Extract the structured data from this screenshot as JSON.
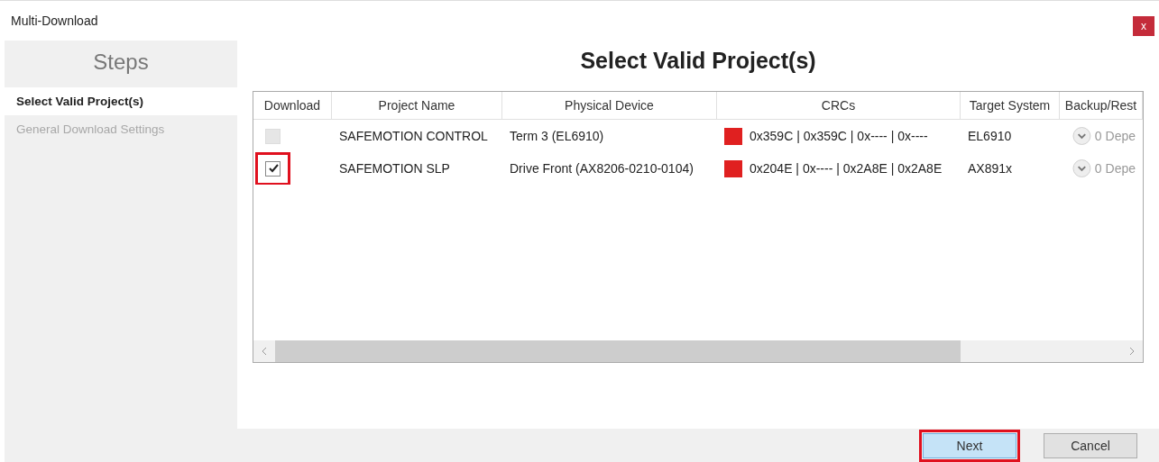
{
  "window": {
    "title": "Multi-Download",
    "close_label": "x"
  },
  "sidebar": {
    "title": "Steps",
    "items": [
      {
        "label": "Select Valid Project(s)",
        "selected": true,
        "disabled": false
      },
      {
        "label": "General Download Settings",
        "selected": false,
        "disabled": true
      }
    ]
  },
  "page_title": "Select Valid Project(s)",
  "table": {
    "columns": [
      "Download",
      "Project Name",
      "Physical Device",
      "CRCs",
      "Target System",
      "Backup/Rest"
    ],
    "rows": [
      {
        "checked": false,
        "disabled": true,
        "highlighted": false,
        "project_name": "SAFEMOTION CONTROL",
        "physical_device": "Term 3 (EL6910)",
        "color": "#e02020",
        "crcs": "0x359C | 0x359C | 0x---- | 0x----",
        "target_system": "EL6910",
        "backup": "0 Depe"
      },
      {
        "checked": true,
        "disabled": false,
        "highlighted": true,
        "project_name": "SAFEMOTION SLP",
        "physical_device": "Drive Front (AX8206-0210-0104)",
        "color": "#e02020",
        "crcs": "0x204E | 0x---- | 0x2A8E | 0x2A8E",
        "target_system": "AX891x",
        "backup": "0 Depe"
      }
    ]
  },
  "buttons": [
    {
      "label": "Next",
      "highlighted": true,
      "kind": "primary"
    },
    {
      "label": "Cancel",
      "highlighted": false,
      "kind": "secondary"
    }
  ]
}
